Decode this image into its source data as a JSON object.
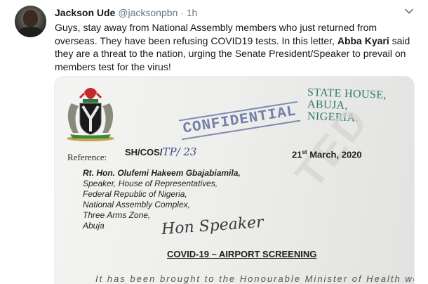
{
  "tweet": {
    "author_name": "Jackson Ude",
    "author_handle": "@jacksonpbn",
    "separator": "·",
    "timestamp": "1h",
    "text_before_bold": "Guys, stay away from National Assembly members who just returned from overseas. They have been refusing COVID19 tests. In this letter, ",
    "text_bold": "Abba Kyari",
    "text_after_bold": " said they are a threat to the nation, urging the Senate President/Speaker to prevail on members test for the virus!",
    "menu_icon": "chevron-down-icon"
  },
  "letter": {
    "address_lines": [
      "STATE HOUSE,",
      "ABUJA,",
      "NIGERIA."
    ],
    "stamp": "CONFIDENTIAL",
    "watermark": "TED",
    "reference_label": "Reference:",
    "reference_number": "SH/COS/",
    "reference_handwritten": "TP/ 23",
    "date_day": "21",
    "date_suffix": "st",
    "date_rest": " March, 2020",
    "recipient_name": "Rt. Hon. Olufemi Hakeem Gbajabiamila,",
    "recipient_lines": [
      "Speaker, House of Representatives,",
      "Federal Republic of Nigeria,",
      "National Assembly Complex,",
      "Three Arms Zone,",
      "Abuja"
    ],
    "handwritten_note": "Hon Speaker",
    "subject": "COVID-19 – AIRPORT SCREENING",
    "body_partial": "It has been brought to the Honourable Minister of Health would"
  },
  "colors": {
    "text": "#14171a",
    "secondary": "#657786",
    "address_ink": "#2f7b6a",
    "stamp_ink": "#5d6e9e"
  }
}
